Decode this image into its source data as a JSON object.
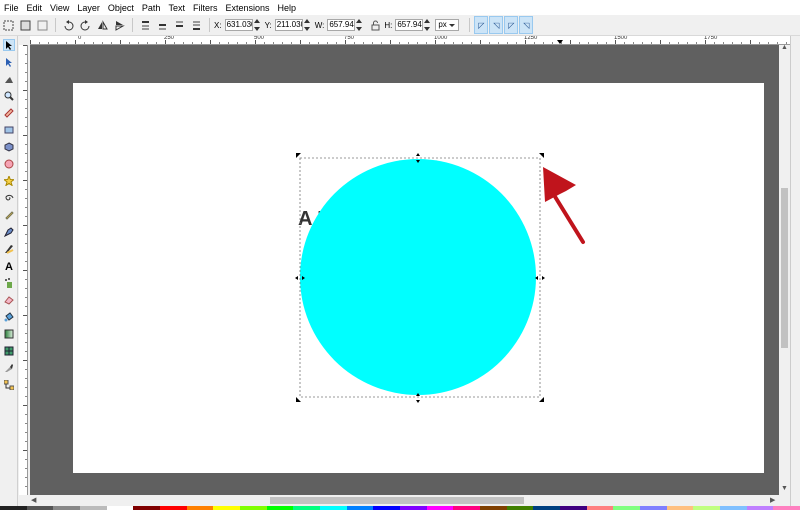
{
  "menu": [
    "File",
    "Edit",
    "View",
    "Layer",
    "Object",
    "Path",
    "Text",
    "Filters",
    "Extensions",
    "Help"
  ],
  "toolbar": {
    "x_label": "X:",
    "x_value": "631.030",
    "y_label": "Y:",
    "y_value": "211.030",
    "w_label": "W:",
    "w_value": "657.941",
    "h_label": "H:",
    "h_value": "657.941",
    "unit": "px"
  },
  "ruler_labels": [
    "0",
    "250",
    "500",
    "750",
    "1000",
    "1250",
    "1500",
    "1750"
  ],
  "canvas_text": "A                              E",
  "colors": {
    "circle_fill": "#00ffff",
    "arrow": "#c0141c",
    "canvas_bg": "#606060",
    "page_bg": "#ffffff"
  },
  "tools": [
    "select-tool",
    "node-tool",
    "tweak-tool",
    "zoom-tool",
    "measure-tool",
    "rectangle-tool",
    "3d-box-tool",
    "ellipse-tool",
    "star-tool",
    "spiral-tool",
    "pencil-tool",
    "pen-tool",
    "calligraphy-tool",
    "text-tool",
    "spray-tool",
    "eraser-tool",
    "bucket-tool",
    "gradient-tool",
    "mesh-tool",
    "dropper-tool",
    "connector-tool"
  ]
}
